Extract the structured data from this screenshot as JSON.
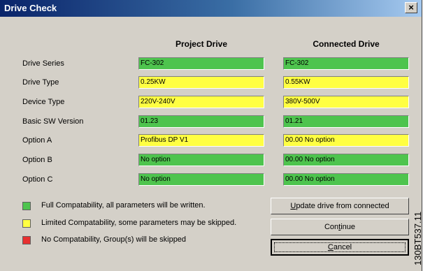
{
  "window": {
    "title": "Drive Check",
    "close_label": "×"
  },
  "columns": {
    "project": "Project Drive",
    "connected": "Connected Drive"
  },
  "colors": {
    "green": "#4ec44e",
    "yellow": "#ffff42",
    "red": "#e83030"
  },
  "rows": [
    {
      "label": "Drive Series",
      "project": "FC-302",
      "connected": "FC-302",
      "project_status": "green",
      "connected_status": "green"
    },
    {
      "label": "Drive Type",
      "project": "0.25KW",
      "connected": "0.55KW",
      "project_status": "yellow",
      "connected_status": "yellow"
    },
    {
      "label": "Device Type",
      "project": "220V-240V",
      "connected": "380V-500V",
      "project_status": "yellow",
      "connected_status": "yellow"
    },
    {
      "label": "Basic SW Version",
      "project": "01.23",
      "connected": "01.21",
      "project_status": "green",
      "connected_status": "green"
    },
    {
      "label": "Option A",
      "project": "Profibus DP V1",
      "connected": "00.00 No option",
      "project_status": "yellow",
      "connected_status": "yellow"
    },
    {
      "label": "Option B",
      "project": "No option",
      "connected": "00.00 No option",
      "project_status": "green",
      "connected_status": "green"
    },
    {
      "label": "Option C",
      "project": "No option",
      "connected": "00.00 No option",
      "project_status": "green",
      "connected_status": "green"
    }
  ],
  "legend": [
    {
      "status": "green",
      "text": "Full Compatability, all parameters will be written."
    },
    {
      "status": "yellow",
      "text": "Limited Compatability, some parameters may be skipped."
    },
    {
      "status": "red",
      "text": "No Compatability, Group(s) will be skipped"
    }
  ],
  "buttons": {
    "update": {
      "mnemonic": "U",
      "rest": "pdate drive from connected"
    },
    "continue": {
      "before": "Con",
      "mnemonic": "t",
      "after": "inue"
    },
    "cancel": {
      "mnemonic": "C",
      "rest": "ancel"
    }
  },
  "figure_number": "130BT537.11"
}
